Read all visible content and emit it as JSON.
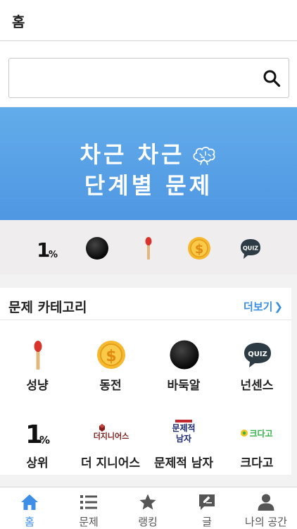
{
  "header": {
    "title": "홈"
  },
  "search": {
    "placeholder": "",
    "value": ""
  },
  "banner": {
    "line1": "차근 차근",
    "line2": "단계별 문제"
  },
  "quick_strip": {
    "items": [
      {
        "icon": "top-percent-icon",
        "text": "1",
        "suffix": "%"
      },
      {
        "icon": "baduk-stone-icon"
      },
      {
        "icon": "match-icon"
      },
      {
        "icon": "coin-icon"
      },
      {
        "icon": "quiz-bubble-icon",
        "text": "QUIZ"
      }
    ]
  },
  "categories": {
    "title": "문제 카테고리",
    "more_label": "더보기",
    "items": [
      {
        "label": "성냥",
        "icon": "match-icon"
      },
      {
        "label": "동전",
        "icon": "coin-icon"
      },
      {
        "label": "바둑알",
        "icon": "baduk-stone-icon"
      },
      {
        "label": "넌센스",
        "icon": "quiz-bubble-icon",
        "icon_text": "QUIZ"
      },
      {
        "label": "상위",
        "icon": "top-percent-icon",
        "icon_text": "1",
        "icon_suffix": "%"
      },
      {
        "label": "더 지니어스",
        "icon": "the-genius-logo-icon",
        "icon_text": "더지니어스"
      },
      {
        "label": "문제적 남자",
        "icon": "problematic-men-logo-icon",
        "icon_text": "문제적남자"
      },
      {
        "label": "크다고",
        "icon": "keudago-logo-icon",
        "icon_text": "크다고"
      }
    ]
  },
  "tabs": [
    {
      "label": "홈",
      "icon": "home-icon",
      "active": true
    },
    {
      "label": "문제",
      "icon": "list-icon",
      "active": false
    },
    {
      "label": "랭킹",
      "icon": "star-icon",
      "active": false
    },
    {
      "label": "글",
      "icon": "edit-note-icon",
      "active": false
    },
    {
      "label": "나의 공간",
      "icon": "user-icon",
      "active": false
    }
  ],
  "colors": {
    "accent": "#3d8ee6",
    "banner": "#5aa3e8",
    "coin": "#f5b82e",
    "match_head": "#d9342b"
  }
}
